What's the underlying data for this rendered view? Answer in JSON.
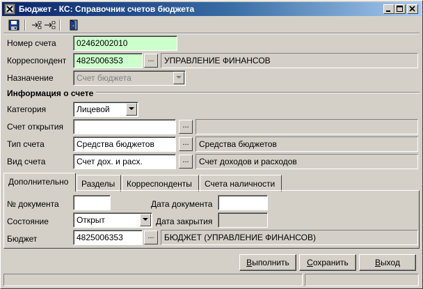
{
  "window": {
    "title": "Бюджет - КС: Справочник счетов бюджета"
  },
  "toolbar": {
    "save_icon": "floppy-disk-icon",
    "tree_icon": "tree-expand-icon",
    "exit_icon": "exit-door-icon"
  },
  "fields": {
    "account_number": {
      "label": "Номер счета",
      "value": "02462002010"
    },
    "correspondent": {
      "label": "Корреспондент",
      "value": "4825006353",
      "name": "УПРАВЛЕНИЕ ФИНАНСОВ"
    },
    "purpose": {
      "label": "Назначение",
      "value": "Счет бюджета"
    }
  },
  "info_section": {
    "title": "Информация о счете"
  },
  "info": {
    "category": {
      "label": "Категория",
      "value": "Лицевой"
    },
    "opening_account": {
      "label": "Счет открытия",
      "value": "",
      "name": ""
    },
    "account_type": {
      "label": "Тип счета",
      "value": "Средства бюджетов",
      "name": "Средства бюджетов"
    },
    "account_kind": {
      "label": "Вид счета",
      "value": "Счет дох. и расх.",
      "name": "Счет доходов и расходов"
    }
  },
  "tabs": [
    "Дополнительно",
    "Разделы",
    "Корреспонденты",
    "Счета наличности"
  ],
  "extra": {
    "doc_number": {
      "label": "№ документа",
      "value": ""
    },
    "doc_date": {
      "label": "Дата документа",
      "value": ""
    },
    "state": {
      "label": "Состояние",
      "value": "Открыт"
    },
    "close_date": {
      "label": "Дата закрытия",
      "value": ""
    },
    "budget": {
      "label": "Бюджет",
      "value": "4825006353",
      "name": "БЮДЖЕТ (УПРАВЛЕНИЕ ФИНАНСОВ)"
    }
  },
  "buttons": {
    "execute": {
      "label": "Выполнить",
      "accel": "В",
      "rest": "ыполнить"
    },
    "save": {
      "label": "Сохранить",
      "accel": "С",
      "rest": "охранить"
    },
    "exit": {
      "label": "Выход",
      "accel": "В",
      "rest": "ыход"
    }
  },
  "ellipsis": "..."
}
